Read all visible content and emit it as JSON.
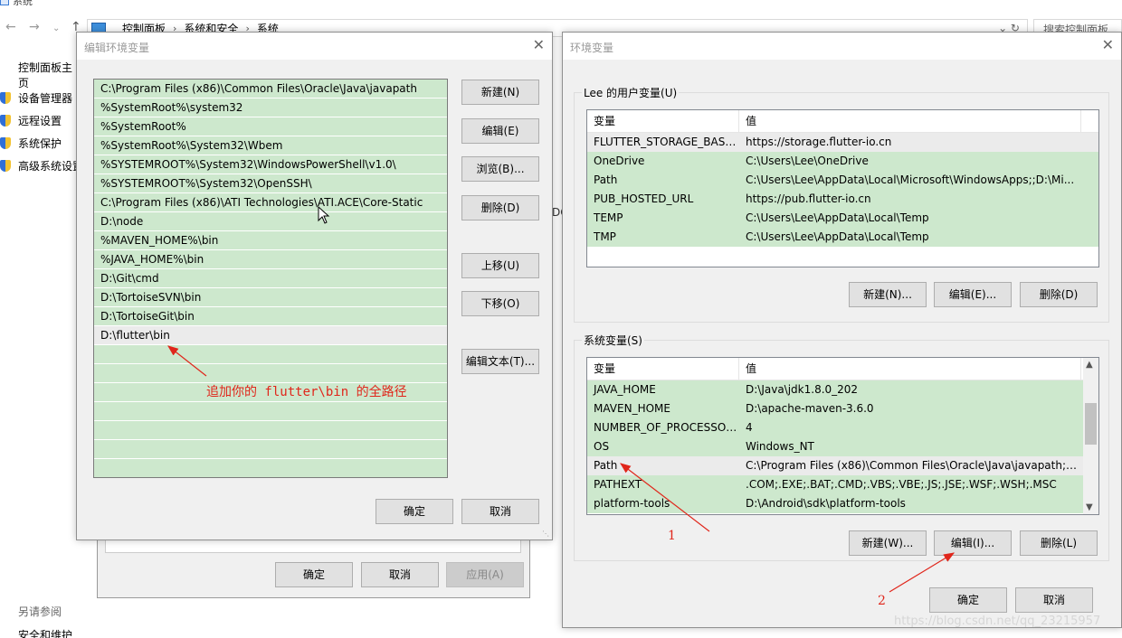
{
  "background_window": {
    "title": "系统",
    "breadcrumb": [
      "控制面板",
      "系统和安全",
      "系统"
    ],
    "search_placeholder": "搜索控制面板",
    "left_home": "控制面板主页",
    "left_links": [
      "设备管理器",
      "远程设置",
      "系统保护",
      "高级系统设置"
    ],
    "see_also": "另请参阅",
    "security_link": "安全和维护",
    "peek_text": "DG"
  },
  "system_properties": {
    "ok": "确定",
    "cancel": "取消",
    "apply": "应用(A)"
  },
  "edit_env_dialog": {
    "title": "编辑环境变量",
    "paths": [
      "C:\\Program Files (x86)\\Common Files\\Oracle\\Java\\javapath",
      "%SystemRoot%\\system32",
      "%SystemRoot%",
      "%SystemRoot%\\System32\\Wbem",
      "%SYSTEMROOT%\\System32\\WindowsPowerShell\\v1.0\\",
      "%SYSTEMROOT%\\System32\\OpenSSH\\",
      "C:\\Program Files (x86)\\ATI Technologies\\ATI.ACE\\Core-Static",
      "D:\\node",
      "%MAVEN_HOME%\\bin",
      "%JAVA_HOME%\\bin",
      "D:\\Git\\cmd",
      "D:\\TortoiseSVN\\bin",
      "D:\\TortoiseGit\\bin",
      "D:\\flutter\\bin"
    ],
    "buttons": {
      "new": "新建(N)",
      "edit": "编辑(E)",
      "browse": "浏览(B)...",
      "delete": "删除(D)",
      "up": "上移(U)",
      "down": "下移(O)",
      "edit_text": "编辑文本(T)...",
      "ok": "确定",
      "cancel": "取消"
    },
    "annotation": "追加你的 flutter\\bin 的全路径"
  },
  "env_dialog": {
    "title": "环境变量",
    "user_group_label": "Lee 的用户变量(U)",
    "col_variable": "变量",
    "col_value": "值",
    "user_vars": [
      {
        "name": "FLUTTER_STORAGE_BASE_...",
        "value": "https://storage.flutter-io.cn"
      },
      {
        "name": "OneDrive",
        "value": "C:\\Users\\Lee\\OneDrive"
      },
      {
        "name": "Path",
        "value": "C:\\Users\\Lee\\AppData\\Local\\Microsoft\\WindowsApps;;D:\\Mi..."
      },
      {
        "name": "PUB_HOSTED_URL",
        "value": "https://pub.flutter-io.cn"
      },
      {
        "name": "TEMP",
        "value": "C:\\Users\\Lee\\AppData\\Local\\Temp"
      },
      {
        "name": "TMP",
        "value": "C:\\Users\\Lee\\AppData\\Local\\Temp"
      }
    ],
    "user_buttons": {
      "new": "新建(N)...",
      "edit": "编辑(E)...",
      "delete": "删除(D)"
    },
    "system_group_label": "系统变量(S)",
    "system_vars": [
      {
        "name": "JAVA_HOME",
        "value": "D:\\Java\\jdk1.8.0_202"
      },
      {
        "name": "MAVEN_HOME",
        "value": "D:\\apache-maven-3.6.0"
      },
      {
        "name": "NUMBER_OF_PROCESSORS",
        "value": "4"
      },
      {
        "name": "OS",
        "value": "Windows_NT"
      },
      {
        "name": "Path",
        "value": "C:\\Program Files (x86)\\Common Files\\Oracle\\Java\\javapath;C:..."
      },
      {
        "name": "PATHEXT",
        "value": ".COM;.EXE;.BAT;.CMD;.VBS;.VBE;.JS;.JSE;.WSF;.WSH;.MSC"
      },
      {
        "name": "platform-tools",
        "value": "D:\\Android\\sdk\\platform-tools"
      }
    ],
    "system_buttons": {
      "new": "新建(W)...",
      "edit": "编辑(I)...",
      "delete": "删除(L)"
    },
    "ok": "确定",
    "cancel": "取消",
    "step1": "1",
    "step2": "2"
  },
  "watermark": "https://blog.csdn.net/qq_23215957",
  "colors": {
    "row_green": "#cde8cd",
    "selected_row": "#ebebeb",
    "annotation_red": "#e0261b"
  }
}
